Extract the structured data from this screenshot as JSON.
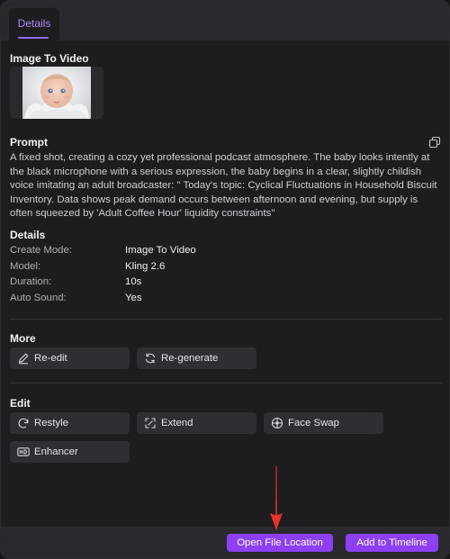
{
  "tabs": [
    {
      "label": "Details",
      "active": true
    }
  ],
  "image_to_video": {
    "heading": "Image To Video"
  },
  "prompt": {
    "heading": "Prompt",
    "text": "A  fixed  shot, creating a cozy yet professional podcast atmosphere. The baby looks intently at the black microphone with a serious expression, the baby begins in a clear, slightly childish voice imitating an adult broadcaster:   \" Today's topic: Cyclical Fluctuations in Household Biscuit Inventory. Data shows peak demand occurs between afternoon and evening, but supply is often squeezed by   'Adult Coffee Hour' liquidity constraints\""
  },
  "details": {
    "heading": "Details",
    "rows": [
      {
        "key": "Create Mode:",
        "value": "Image To Video"
      },
      {
        "key": "Model:",
        "value": "Kling 2.6"
      },
      {
        "key": "Duration:",
        "value": "10s"
      },
      {
        "key": "Auto Sound:",
        "value": "Yes"
      }
    ]
  },
  "more": {
    "heading": "More",
    "buttons": [
      {
        "label": "Re-edit",
        "icon": "pencil-icon"
      },
      {
        "label": "Re-generate",
        "icon": "refresh-icon"
      }
    ]
  },
  "edit": {
    "heading": "Edit",
    "buttons": [
      {
        "label": "Restyle",
        "icon": "restyle-icon"
      },
      {
        "label": "Extend",
        "icon": "expand-icon"
      },
      {
        "label": "Face Swap",
        "icon": "face-swap-icon"
      },
      {
        "label": "Enhancer",
        "icon": "hd-icon"
      }
    ]
  },
  "footer": {
    "open_location_label": "Open File Location",
    "add_timeline_label": "Add to Timeline"
  },
  "colors": {
    "accent": "#8c3ff3",
    "tab_active": "#a98bf5",
    "annotation_arrow": "#e8322a",
    "background": "#1d1d20"
  }
}
